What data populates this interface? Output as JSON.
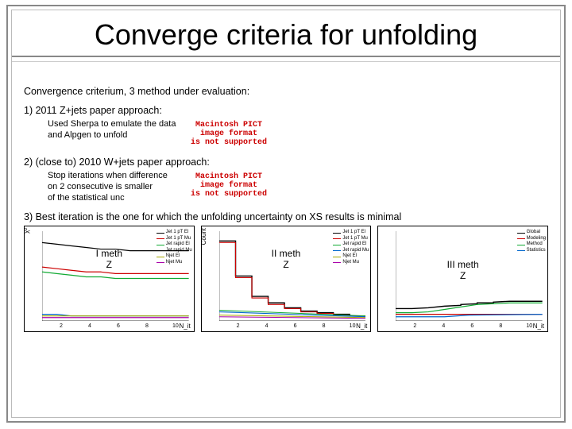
{
  "title": "Converge criteria for unfolding",
  "subhead": "Convergence criterium, 3 method under evaluation:",
  "method1": "1) 2011 Z+jets paper approach:",
  "method1_note": "Used Sherpa to emulate the data\nand Alpgen to unfold",
  "method2": "2) (close to) 2010 W+jets paper approach:",
  "method2_note": "Stop iterations when difference\non 2 consecutive  is smaller\nof the statistical unc",
  "method3": "3) Best iteration is the one for which the unfolding uncertainty on XS results is minimal",
  "pict_l1": "Macintosh PICT",
  "pict_l2": "image format",
  "pict_l3": "is not supported",
  "charts": [
    {
      "label": "I meth\nZ",
      "ylabel": "χ²",
      "xlabel": "N_it"
    },
    {
      "label": "II meth\nZ",
      "ylabel": "Count",
      "xlabel": "N_it"
    },
    {
      "label": "III meth\nZ",
      "ylabel": "",
      "xlabel": "N_it"
    }
  ],
  "tick_vals": [
    "2",
    "4",
    "6",
    "8",
    "10"
  ],
  "legend_set_a": [
    {
      "c": "#000",
      "t": "Jet 1 pT El"
    },
    {
      "c": "#c00",
      "t": "Jet 1 pT Mu"
    },
    {
      "c": "#1a3",
      "t": "Jet rapid El"
    },
    {
      "c": "#06c",
      "t": "Jet rapid Mu"
    },
    {
      "c": "#a8a800",
      "t": "Njet El"
    },
    {
      "c": "#a0a",
      "t": "Njet Mu"
    }
  ],
  "legend_set_b": [
    {
      "c": "#000",
      "t": "Global"
    },
    {
      "c": "#c00",
      "t": "Modeling"
    },
    {
      "c": "#1a3",
      "t": "Method"
    },
    {
      "c": "#06c",
      "t": "Statistics"
    }
  ],
  "chart_data": [
    {
      "type": "line",
      "title": "I meth Z",
      "xlabel": "N_it",
      "ylabel": "χ²",
      "x": [
        1,
        2,
        3,
        4,
        5,
        6,
        7,
        8,
        9,
        10
      ],
      "ylim": [
        0,
        40
      ],
      "series": [
        {
          "name": "Jet 1 pT El",
          "color": "#000",
          "values": [
            35,
            34,
            33,
            32,
            31,
            31,
            30,
            30,
            30,
            30
          ]
        },
        {
          "name": "Jet 1 pT Mu",
          "color": "#c00",
          "values": [
            24,
            23,
            22,
            21,
            21,
            20,
            20,
            20,
            20,
            20
          ]
        },
        {
          "name": "Jet rapid El",
          "color": "#1a3",
          "values": [
            22,
            21,
            20,
            19,
            19,
            18,
            18,
            18,
            18,
            18
          ]
        },
        {
          "name": "Jet rapid Mu",
          "color": "#06c",
          "values": [
            3,
            3,
            2,
            2,
            2,
            2,
            2,
            2,
            2,
            2
          ]
        },
        {
          "name": "Njet El",
          "color": "#a8a800",
          "values": [
            2,
            2,
            2,
            2,
            2,
            2,
            2,
            2,
            2,
            2
          ]
        },
        {
          "name": "Njet Mu",
          "color": "#a0a",
          "values": [
            1,
            1,
            1,
            1,
            1,
            1,
            1,
            1,
            1,
            1
          ]
        }
      ]
    },
    {
      "type": "line",
      "title": "II meth Z",
      "xlabel": "N_it",
      "ylabel": "Count",
      "x": [
        1,
        2,
        3,
        4,
        5,
        6,
        7,
        8,
        9,
        10
      ],
      "ylim": [
        0.9,
        1.7
      ],
      "series": [
        {
          "name": "Jet 1 pT El",
          "color": "#000",
          "values": [
            1.62,
            1.3,
            1.12,
            1.08,
            1.05,
            1.04,
            1.03,
            1.02,
            1.01,
            1.0
          ]
        },
        {
          "name": "Jet 1 pT Mu",
          "color": "#c00",
          "values": [
            1.62,
            1.3,
            1.12,
            1.08,
            1.05,
            1.04,
            1.03,
            1.02,
            1.01,
            1.0
          ]
        },
        {
          "name": "Jet rapid El",
          "color": "#1a3",
          "values": [
            1.05,
            1.03,
            1.02,
            1.02,
            1.01,
            1.01,
            1.0,
            1.0,
            1.0,
            1.0
          ]
        },
        {
          "name": "Jet rapid Mu",
          "color": "#06c",
          "values": [
            1.03,
            1.02,
            1.01,
            1.01,
            1.0,
            1.0,
            1.0,
            1.0,
            1.0,
            1.0
          ]
        },
        {
          "name": "Njet El",
          "color": "#a8a800",
          "values": [
            1.01,
            1.01,
            1.0,
            1.0,
            1.0,
            1.0,
            1.0,
            1.0,
            1.0,
            1.0
          ]
        },
        {
          "name": "Njet Mu",
          "color": "#a0a",
          "values": [
            1.01,
            1.0,
            1.0,
            1.0,
            1.0,
            1.0,
            1.0,
            1.0,
            1.0,
            1.0
          ]
        }
      ]
    },
    {
      "type": "line",
      "title": "III meth Z",
      "xlabel": "N_it",
      "ylabel": "",
      "x": [
        1,
        2,
        3,
        4,
        5,
        6,
        7,
        8,
        9,
        10
      ],
      "ylim": [
        0,
        45
      ],
      "series": [
        {
          "name": "Global",
          "color": "#000",
          "values": [
            6,
            6,
            6,
            7,
            7,
            8,
            8,
            9,
            9,
            9
          ]
        },
        {
          "name": "Modeling",
          "color": "#c00",
          "values": [
            3,
            3,
            3,
            3,
            3,
            3,
            3,
            3,
            3,
            3
          ]
        },
        {
          "name": "Method",
          "color": "#1a3",
          "values": [
            4,
            4,
            5,
            6,
            7,
            8,
            8,
            9,
            9,
            9
          ]
        },
        {
          "name": "Statistics",
          "color": "#06c",
          "values": [
            2,
            2,
            2,
            2,
            2,
            3,
            3,
            3,
            3,
            3
          ]
        }
      ]
    }
  ]
}
